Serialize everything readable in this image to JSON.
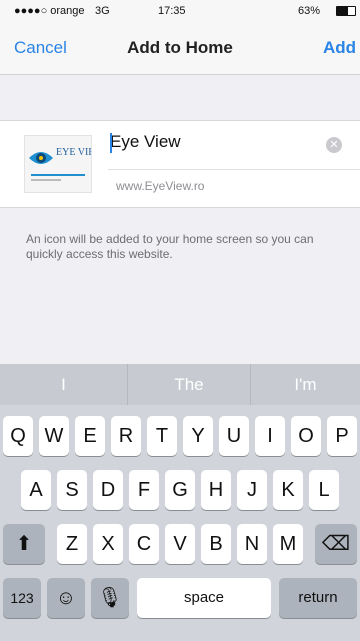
{
  "status_bar": {
    "carrier": "●●●●○ orange",
    "network": "3G",
    "time": "17:35",
    "battery_text": "63%",
    "battery_level": 0.63
  },
  "nav": {
    "cancel_label": "Cancel",
    "title": "Add to Home",
    "add_label": "Add"
  },
  "bookmark": {
    "name_value": "Eye View",
    "url": "www.EyeView.ro",
    "thumb_text": "EYE VIEW"
  },
  "note": "An icon will be added to your home screen so you can quickly access this website.",
  "suggestions": [
    "I",
    "The",
    "I'm"
  ],
  "keyboard": {
    "row1": [
      "Q",
      "W",
      "E",
      "R",
      "T",
      "Y",
      "U",
      "I",
      "O",
      "P"
    ],
    "row2": [
      "A",
      "S",
      "D",
      "F",
      "G",
      "H",
      "J",
      "K",
      "L"
    ],
    "row3": [
      "Z",
      "X",
      "C",
      "V",
      "B",
      "N",
      "M"
    ],
    "num_key": "123",
    "space_key": "space",
    "return_key": "return"
  },
  "colors": {
    "accent": "#2a84e5",
    "background": "#efeff4"
  }
}
